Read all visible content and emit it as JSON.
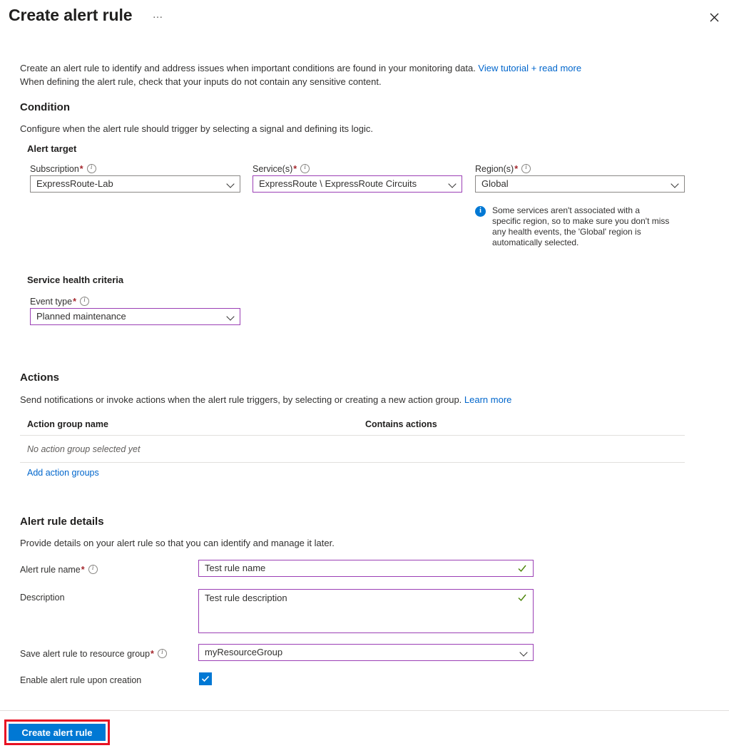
{
  "header": {
    "title": "Create alert rule",
    "more_menu": "…",
    "close_icon": "close-icon"
  },
  "intro": {
    "line1_pre": "Create an alert rule to identify and address issues when important conditions are found in your monitoring data. ",
    "link": "View tutorial + read more",
    "line2": "When defining the alert rule, check that your inputs do not contain any sensitive content."
  },
  "condition": {
    "heading": "Condition",
    "subtitle": "Configure when the alert rule should trigger by selecting a signal and defining its logic.",
    "alert_target_heading": "Alert target",
    "subscription": {
      "label": "Subscription",
      "required": "*",
      "value": "ExpressRoute-Lab"
    },
    "services": {
      "label": "Service(s)",
      "required": "*",
      "value": "ExpressRoute \\ ExpressRoute Circuits"
    },
    "regions": {
      "label": "Region(s)",
      "required": "*",
      "value": "Global"
    },
    "region_note": "Some services aren't associated with a specific region, so to make sure you don't miss any health events, the 'Global' region is automatically selected.",
    "service_health_heading": "Service health criteria",
    "event_type": {
      "label": "Event type",
      "required": "*",
      "value": "Planned maintenance"
    }
  },
  "actions": {
    "heading": "Actions",
    "subtitle_pre": "Send notifications or invoke actions when the alert rule triggers, by selecting or creating a new action group. ",
    "subtitle_link": "Learn more",
    "table": {
      "columns": [
        "Action group name",
        "Contains actions"
      ],
      "empty_text": "No action group selected yet"
    },
    "add_link": "Add action groups"
  },
  "alert_rule_details": {
    "heading": "Alert rule details",
    "subtitle": "Provide details on your alert rule so that you can identify and manage it later.",
    "rule_name": {
      "label": "Alert rule name",
      "required": "*",
      "value": "Test rule name"
    },
    "description": {
      "label": "Description",
      "value": "Test rule description"
    },
    "resource_group": {
      "label": "Save alert rule to resource group",
      "required": "*",
      "value": "myResourceGroup"
    },
    "enable_on_create": {
      "label": "Enable alert rule upon creation",
      "checked": true
    }
  },
  "footer": {
    "create_button": "Create alert rule"
  },
  "colors": {
    "accent_blue": "#0078d4",
    "link_blue": "#0066cc",
    "required_red": "#a4262c",
    "highlight_red": "#e81123",
    "field_accent_purple": "#9b3fb5",
    "valid_green": "#498205"
  }
}
